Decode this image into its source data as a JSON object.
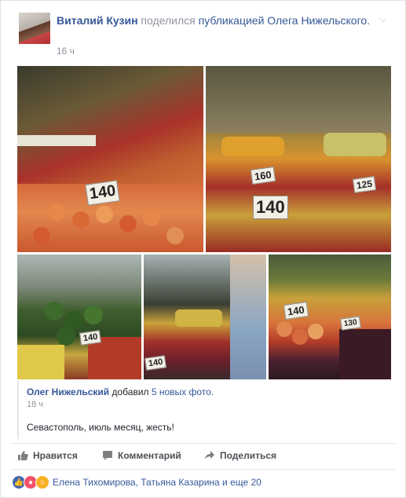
{
  "post": {
    "author": "Виталий Кузин",
    "shared_text": "поделился",
    "publication_text": "публикацией Олега Нижельского.",
    "time": "16 ч"
  },
  "photos": {
    "labels": [
      "140",
      "140",
      "160",
      "125",
      "140",
      "140",
      "140",
      "130"
    ]
  },
  "shared": {
    "author": "Олег Нижельский",
    "added_text": "добавил",
    "photos_link": "5 новых фото.",
    "time": "18 ч",
    "text": "Севастополь, июль месяц, жесть!"
  },
  "actions": {
    "like": "Нравится",
    "comment": "Комментарий",
    "share": "Поделиться"
  },
  "reactions": {
    "names": "Елена Тихомирова, Татьяна Казарина и еще 20"
  },
  "colors": {
    "link": "#365899",
    "like_icon": "#4267b2",
    "angry_icon": "#f25268",
    "wow_icon": "#f7b125"
  }
}
